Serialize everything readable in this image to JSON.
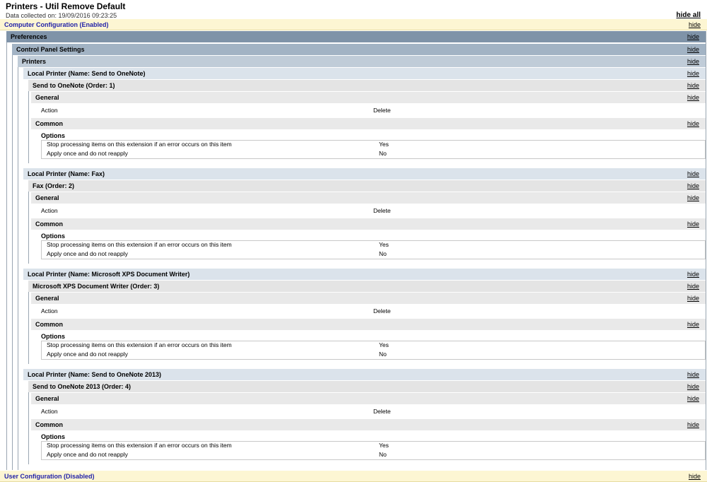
{
  "page": {
    "title": "Printers - Util Remove Default",
    "data_collected": "Data collected on: 19/09/2016 09:23:25",
    "hide_all_label": "hide all",
    "hide_label": "hide"
  },
  "computer_config": {
    "label": "Computer Configuration (Enabled)"
  },
  "preferences": {
    "label": "Preferences"
  },
  "control_panel": {
    "label": "Control Panel Settings"
  },
  "printers_section": {
    "label": "Printers"
  },
  "printers": [
    {
      "header": "Local Printer (Name: Send to OneNote)",
      "item": "Send to OneNote (Order: 1)",
      "general": "General",
      "action_label": "Action",
      "action_value": "Delete",
      "common": "Common",
      "options_title": "Options",
      "opt1_label": "Stop processing items on this extension if an error occurs on this item",
      "opt1_value": "Yes",
      "opt2_label": "Apply once and do not reapply",
      "opt2_value": "No"
    },
    {
      "header": "Local Printer (Name: Fax)",
      "item": "Fax (Order: 2)",
      "general": "General",
      "action_label": "Action",
      "action_value": "Delete",
      "common": "Common",
      "options_title": "Options",
      "opt1_label": "Stop processing items on this extension if an error occurs on this item",
      "opt1_value": "Yes",
      "opt2_label": "Apply once and do not reapply",
      "opt2_value": "No"
    },
    {
      "header": "Local Printer (Name: Microsoft XPS Document Writer)",
      "item": "Microsoft XPS Document Writer (Order: 3)",
      "general": "General",
      "action_label": "Action",
      "action_value": "Delete",
      "common": "Common",
      "options_title": "Options",
      "opt1_label": "Stop processing items on this extension if an error occurs on this item",
      "opt1_value": "Yes",
      "opt2_label": "Apply once and do not reapply",
      "opt2_value": "No"
    },
    {
      "header": "Local Printer (Name: Send to OneNote 2013)",
      "item": "Send to OneNote 2013 (Order: 4)",
      "general": "General",
      "action_label": "Action",
      "action_value": "Delete",
      "common": "Common",
      "options_title": "Options",
      "opt1_label": "Stop processing items on this extension if an error occurs on this item",
      "opt1_value": "Yes",
      "opt2_label": "Apply once and do not reapply",
      "opt2_value": "No"
    }
  ],
  "user_config": {
    "label": "User Configuration (Disabled)"
  },
  "colors": {
    "config_bg": "#fdf6d3",
    "config_text": "#2323a8",
    "preferences_bg": "#7f93a8",
    "control_panel_bg": "#a2b3c4",
    "printers_bg": "#c0ccd8",
    "local_printer_bg": "#dbe3eb",
    "item_bg": "#e4e4e4"
  }
}
